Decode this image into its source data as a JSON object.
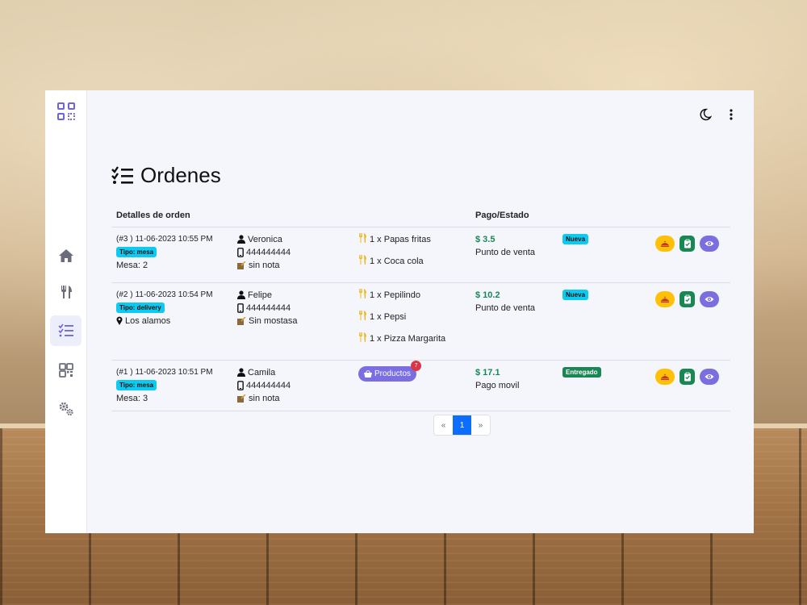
{
  "page": {
    "title": "Ordenes"
  },
  "table": {
    "headers": {
      "details": "Detalles de orden",
      "payment": "Pago/Estado"
    },
    "rows": [
      {
        "order": "(#3 )",
        "datetime": "11-06-2023 10:55 PM",
        "tipo": "Tipo: mesa",
        "location": "Mesa: 2",
        "customer": "Veronica",
        "phone": "444444444",
        "note": "sin nota",
        "items": [
          "1 x Papas fritas",
          "1 x Coca cola"
        ],
        "price": "$ 3.5",
        "payment_method": "Punto de venta",
        "status": "Nueva",
        "status_color": "#0dcaf0"
      },
      {
        "order": "(#2 )",
        "datetime": "11-06-2023 10:54 PM",
        "tipo": "Tipo: delivery",
        "location": "Los alamos",
        "customer": "Felipe",
        "phone": "444444444",
        "note": "Sin mostasa",
        "items": [
          "1 x Pepilindo",
          "1 x Pepsi",
          "1 x Pizza Margarita"
        ],
        "price": "$ 10.2",
        "payment_method": "Punto de venta",
        "status": "Nueva",
        "status_color": "#0dcaf0"
      },
      {
        "order": "(#1 )",
        "datetime": "11-06-2023 10:51 PM",
        "tipo": "Tipo: mesa",
        "location": "Mesa: 3",
        "customer": "Camila",
        "phone": "444444444",
        "note": "sin nota",
        "products_button": "Productos",
        "products_count": "7",
        "price": "$ 17.1",
        "payment_method": "Pago movil",
        "status": "Entregado",
        "status_color": "#198754"
      }
    ]
  },
  "pagination": {
    "prev": "«",
    "current": "1",
    "next": "»"
  },
  "colors": {
    "accent": "#6f63d9",
    "price": "#198754",
    "primary": "#0d6efd"
  },
  "icons": {
    "sidebar": [
      "qr-code-icon",
      "home-icon",
      "utensils-icon",
      "checklist-icon",
      "qr-code-icon",
      "gears-icon"
    ],
    "topbar": [
      "moon-icon",
      "kebab-menu-icon"
    ],
    "actions": [
      "food-delivery-icon",
      "clipboard-check-icon",
      "eye-icon"
    ]
  }
}
